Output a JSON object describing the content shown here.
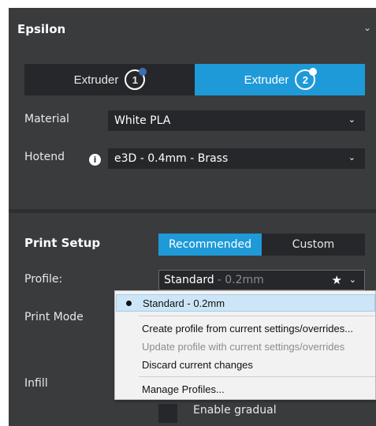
{
  "printer": {
    "name": "Epsilon"
  },
  "extruders": [
    {
      "label": "Extruder",
      "number": "1",
      "active": false,
      "dot_color": "#3a6fb0"
    },
    {
      "label": "Extruder",
      "number": "2",
      "active": true,
      "dot_color": "#ffffff"
    }
  ],
  "material": {
    "label": "Material",
    "value": "White PLA"
  },
  "hotend": {
    "label": "Hotend",
    "value": "e3D - 0.4mm - Brass"
  },
  "print_setup": {
    "title": "Print Setup",
    "tabs": [
      "Recommended",
      "Custom"
    ],
    "active_tab": "Recommended"
  },
  "profile": {
    "label": "Profile:",
    "name": "Standard",
    "sub": "- 0.2mm"
  },
  "print_mode": {
    "label": "Print Mode"
  },
  "infill": {
    "label": "Infill"
  },
  "enable_gradual": {
    "label": "Enable gradual",
    "checked": false
  },
  "profile_menu": {
    "selected": "Standard - 0.2mm",
    "create": "Create profile from current settings/overrides...",
    "update": "Update profile with current settings/overrides",
    "discard": "Discard current changes",
    "manage": "Manage Profiles..."
  },
  "colors": {
    "accent": "#1e9ad8",
    "panel": "#3a3b3d",
    "field": "#26272a"
  }
}
